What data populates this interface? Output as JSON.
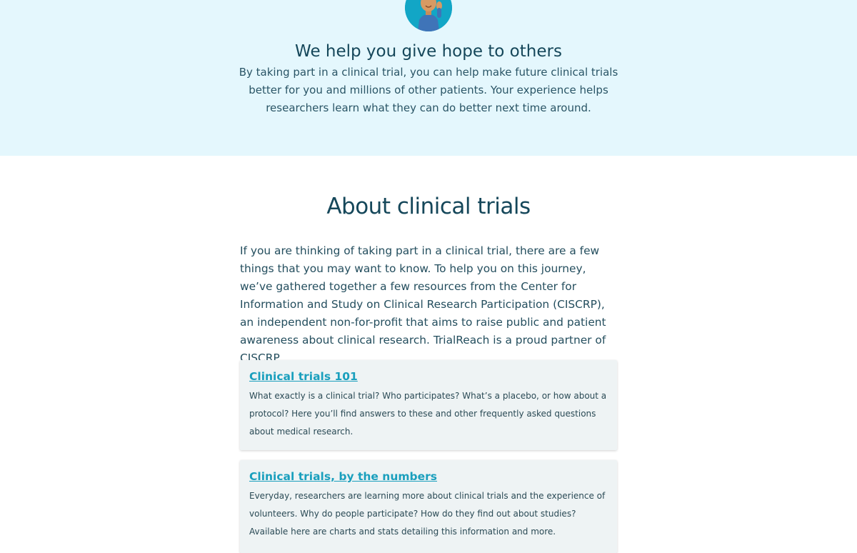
{
  "hero": {
    "title": "We help you give hope to others",
    "text": "By taking part in a clinical trial, you can help make future clinical trials better for you and millions of other patients. Your experience helps researchers learn what they can do better next time around.",
    "background_color": "#e4f7fd",
    "avatar_icon": "person-avatar-icon"
  },
  "about": {
    "title": "About clinical trials",
    "text": "If you are thinking of taking part in a clinical trial, there are a few things that you may want to know. To help you on this journey, we’ve gathered together a few resources from the Center for Information and Study on Clinical Research Participation (CISCRP), an independent non-for-profit that aims to raise public and patient awareness about clinical research. TrialReach is a proud partner of CISCRP."
  },
  "resources": [
    {
      "title": "Clinical trials 101",
      "description": "What exactly is a clinical trial? Who participates? What’s a placebo, or how about a protocol? Here you’ll find answers to these and other frequently asked questions about medical research."
    },
    {
      "title": "Clinical trials, by the numbers",
      "description": "Everyday, researchers are learning more about clinical trials and the experience of volunteers. Why do people participate? How do they find out about studies? Available here are charts and stats detailing this information and more."
    }
  ],
  "colors": {
    "accent_link": "#1a9fbd",
    "heading": "#15475a",
    "card_background": "#eef3f4"
  }
}
